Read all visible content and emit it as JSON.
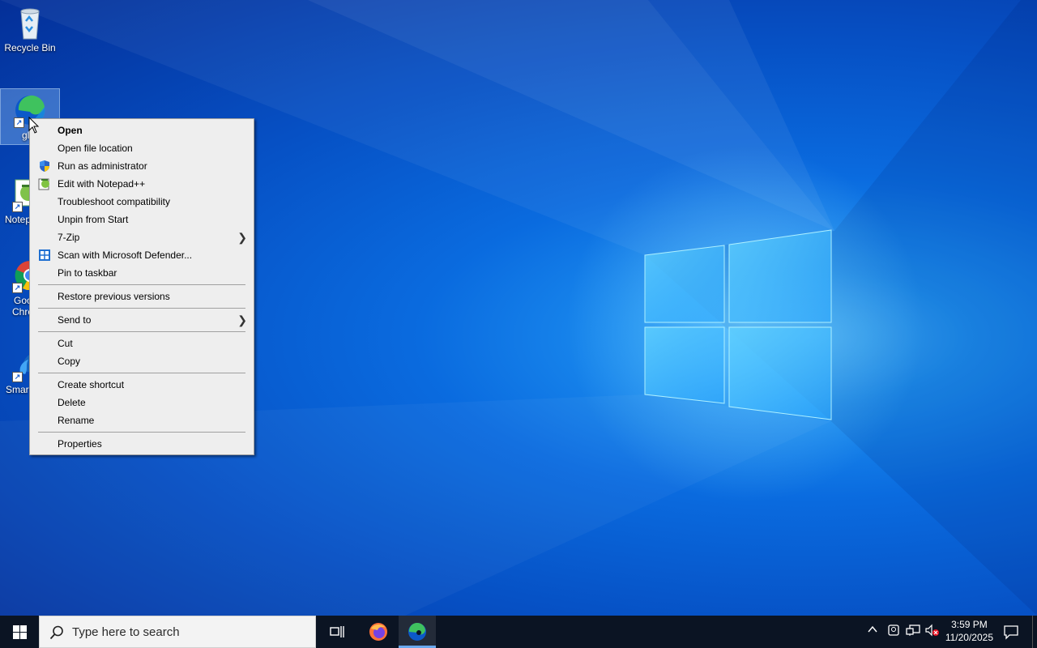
{
  "desktop": {
    "icons": [
      {
        "label": "Recycle Bin",
        "icon": "recycle-bin-icon"
      },
      {
        "label": "gl",
        "icon": "edge-icon"
      },
      {
        "label": "Notep",
        "icon": "notepad-plus-plus-icon"
      },
      {
        "label": "Goo",
        "label2": "Chro",
        "icon": "chrome-icon"
      },
      {
        "label": "Smar",
        "icon": "smart-app-icon"
      }
    ]
  },
  "context_menu": {
    "items": [
      {
        "label": "Open",
        "icon": "",
        "bold": true
      },
      {
        "label": "Open file location",
        "icon": ""
      },
      {
        "label": "Run as administrator",
        "icon": "uac-shield-icon"
      },
      {
        "label": "Edit with Notepad++",
        "icon": "notepad-plus-plus-icon"
      },
      {
        "label": "Troubleshoot compatibility",
        "icon": ""
      },
      {
        "label": "Unpin from Start",
        "icon": ""
      },
      {
        "label": "7-Zip",
        "icon": "",
        "submenu": true
      },
      {
        "label": "Scan with Microsoft Defender...",
        "icon": "defender-icon"
      },
      {
        "label": "Pin to taskbar",
        "icon": ""
      },
      {
        "label": "Restore previous versions",
        "icon": ""
      },
      {
        "label": "Send to",
        "icon": "",
        "submenu": true
      },
      {
        "label": "Cut",
        "icon": ""
      },
      {
        "label": "Copy",
        "icon": ""
      },
      {
        "label": "Create shortcut",
        "icon": ""
      },
      {
        "label": "Delete",
        "icon": ""
      },
      {
        "label": "Rename",
        "icon": ""
      },
      {
        "label": "Properties",
        "icon": ""
      }
    ]
  },
  "taskbar": {
    "search_placeholder": "Type here to search",
    "apps": [
      "task-view-icon",
      "firefox-icon",
      "edge-icon"
    ],
    "tray": [
      "chevron-up-icon",
      "meet-now-icon",
      "network-icon",
      "volume-muted-icon"
    ],
    "time": "3:59 PM",
    "date": "11/20/2025",
    "notifications": "action-center-icon"
  },
  "colors": {
    "menu_bg": "#eeeeee",
    "taskbar_bg": "#0b1423",
    "desktop_accent": "#0a6bdf"
  }
}
